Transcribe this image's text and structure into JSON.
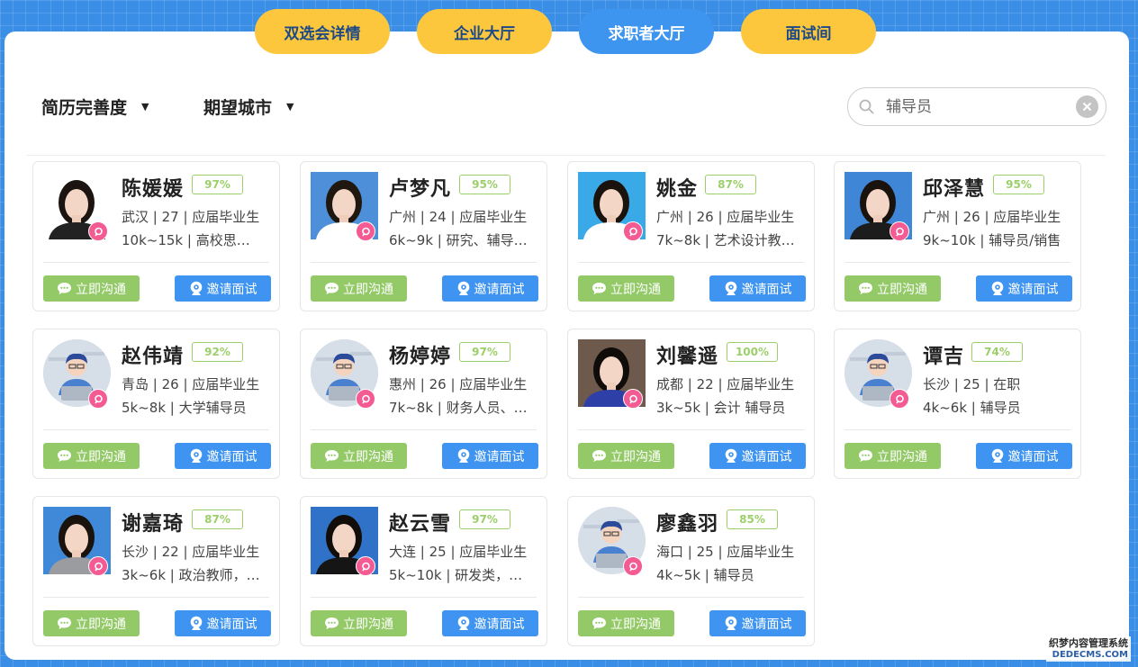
{
  "tabs": [
    {
      "label": "双选会详情",
      "active": false
    },
    {
      "label": "企业大厅",
      "active": false
    },
    {
      "label": "求职者大厅",
      "active": true
    },
    {
      "label": "面试间",
      "active": false
    }
  ],
  "filters": {
    "resume_completeness": "简历完善度",
    "expected_city": "期望城市"
  },
  "search": {
    "value": "",
    "placeholder": "辅导员"
  },
  "buttons": {
    "chat": "立即沟通",
    "invite": "邀请面试"
  },
  "candidates": [
    {
      "name": "陈媛媛",
      "percent": "97%",
      "info": "武汉 | 27 | 应届毕业生",
      "salary_job": "10k~15k | 高校思…",
      "avatar": "photo",
      "bg": "#ffffff",
      "shirt": "#222222",
      "hair": "#1b1410"
    },
    {
      "name": "卢梦凡",
      "percent": "95%",
      "info": "广州 | 24 | 应届毕业生",
      "salary_job": "6k~9k | 研究、辅导…",
      "avatar": "photo",
      "bg": "#4d8fd8",
      "shirt": "#ffffff",
      "hair": "#20170f"
    },
    {
      "name": "姚金",
      "percent": "87%",
      "info": "广州 | 26 | 应届毕业生",
      "salary_job": "7k~8k | 艺术设计教…",
      "avatar": "photo",
      "bg": "#3aa9e8",
      "shirt": "#ffffff",
      "hair": "#1a120c"
    },
    {
      "name": "邱泽慧",
      "percent": "95%",
      "info": "广州 | 26 | 应届毕业生",
      "salary_job": "9k~10k | 辅导员/销售",
      "avatar": "photo",
      "bg": "#3f86d6",
      "shirt": "#1c1c1c",
      "hair": "#1a120c"
    },
    {
      "name": "赵伟靖",
      "percent": "92%",
      "info": "青岛 | 26 | 应届毕业生",
      "salary_job": "5k~8k | 大学辅导员",
      "avatar": "default"
    },
    {
      "name": "杨婷婷",
      "percent": "97%",
      "info": "惠州 | 26 | 应届毕业生",
      "salary_job": "7k~8k | 财务人员、…",
      "avatar": "default"
    },
    {
      "name": "刘馨遥",
      "percent": "100%",
      "info": "成都 | 22 | 应届毕业生",
      "salary_job": "3k~5k | 会计 辅导员",
      "avatar": "photo",
      "bg": "#6d5a4c",
      "shirt": "#2f3fa8",
      "hair": "#100c0a"
    },
    {
      "name": "谭吉",
      "percent": "74%",
      "info": "长沙 | 25 | 在职",
      "salary_job": "4k~6k | 辅导员",
      "avatar": "default"
    },
    {
      "name": "谢嘉琦",
      "percent": "87%",
      "info": "长沙 | 22 | 应届毕业生",
      "salary_job": "3k~6k | 政治教师，…",
      "avatar": "photo",
      "bg": "#3f89d8",
      "shirt": "#9a9ca0",
      "hair": "#1a120c"
    },
    {
      "name": "赵云雪",
      "percent": "97%",
      "info": "大连 | 25 | 应届毕业生",
      "salary_job": "5k~10k | 研发类，…",
      "avatar": "photo",
      "bg": "#2f72c8",
      "shirt": "#151515",
      "hair": "#120d09"
    },
    {
      "name": "廖鑫羽",
      "percent": "85%",
      "info": "海口 | 25 | 应届毕业生",
      "salary_job": "4k~5k | 辅导员",
      "avatar": "default"
    }
  ],
  "watermark": {
    "line1": "织梦内容管理系统",
    "line2": "DEDECMS.COM"
  }
}
